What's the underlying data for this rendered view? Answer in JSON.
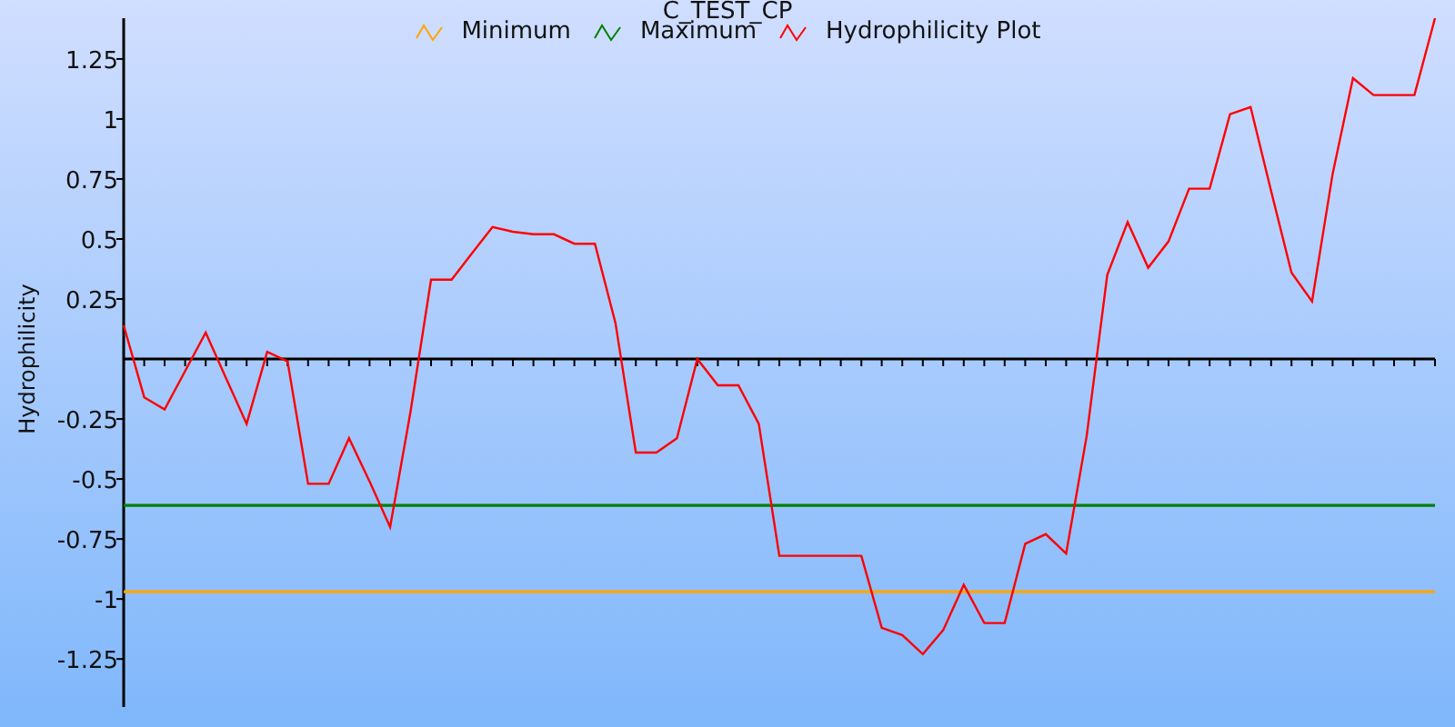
{
  "plot": {
    "chart_data": {
      "type": "line",
      "title": "C_TEST_CP",
      "legend": true,
      "ylabel": "Hydrophilicity",
      "ylim": [
        -1.45,
        1.42
      ],
      "yticks": [
        -1.25,
        -1,
        -0.75,
        -0.5,
        -0.25,
        0.25,
        0.5,
        0.75,
        1,
        1.25
      ],
      "series": [
        {
          "name": "Minimum",
          "color": "#ffa500",
          "values": [
            -0.97,
            -0.97,
            -0.97,
            -0.97,
            -0.97,
            -0.97,
            -0.97,
            -0.97,
            -0.97,
            -0.97,
            -0.97,
            -0.97,
            -0.97,
            -0.97,
            -0.97,
            -0.97,
            -0.97,
            -0.97,
            -0.97,
            -0.97,
            -0.97,
            -0.97,
            -0.97,
            -0.97,
            -0.97,
            -0.97,
            -0.97,
            -0.97,
            -0.97,
            -0.97,
            -0.97,
            -0.97,
            -0.97,
            -0.97,
            -0.97,
            -0.97,
            -0.97,
            -0.97,
            -0.97,
            -0.97,
            -0.97,
            -0.97,
            -0.97,
            -0.97,
            -0.97,
            -0.97,
            -0.97,
            -0.97,
            -0.97,
            -0.97,
            -0.97,
            -0.97,
            -0.97,
            -0.97,
            -0.97,
            -0.97,
            -0.97,
            -0.97,
            -0.97,
            -0.97,
            -0.97,
            -0.97,
            -0.97,
            -0.97,
            -0.97
          ]
        },
        {
          "name": "Maximum",
          "color": "#008000",
          "values": [
            -0.61,
            -0.61,
            -0.61,
            -0.61,
            -0.61,
            -0.61,
            -0.61,
            -0.61,
            -0.61,
            -0.61,
            -0.61,
            -0.61,
            -0.61,
            -0.61,
            -0.61,
            -0.61,
            -0.61,
            -0.61,
            -0.61,
            -0.61,
            -0.61,
            -0.61,
            -0.61,
            -0.61,
            -0.61,
            -0.61,
            -0.61,
            -0.61,
            -0.61,
            -0.61,
            -0.61,
            -0.61,
            -0.61,
            -0.61,
            -0.61,
            -0.61,
            -0.61,
            -0.61,
            -0.61,
            -0.61,
            -0.61,
            -0.61,
            -0.61,
            -0.61,
            -0.61,
            -0.61,
            -0.61,
            -0.61,
            -0.61,
            -0.61,
            -0.61,
            -0.61,
            -0.61,
            -0.61,
            -0.61,
            -0.61,
            -0.61,
            -0.61,
            -0.61,
            -0.61,
            -0.61,
            -0.61,
            -0.61,
            -0.61,
            -0.61
          ]
        },
        {
          "name": "Hydrophilicity Plot",
          "color": "#ff0000",
          "values": [
            0.14,
            -0.16,
            -0.21,
            -0.05,
            0.11,
            -0.08,
            -0.27,
            0.03,
            -0.01,
            -0.52,
            -0.52,
            -0.33,
            -0.51,
            -0.7,
            -0.22,
            0.33,
            0.33,
            0.44,
            0.55,
            0.53,
            0.52,
            0.52,
            0.48,
            0.48,
            0.15,
            -0.39,
            -0.39,
            -0.33,
            0,
            -0.11,
            -0.11,
            -0.27,
            -0.82,
            -0.82,
            -0.82,
            -0.82,
            -0.82,
            -1.12,
            -1.15,
            -1.23,
            -1.13,
            -0.94,
            -1.1,
            -1.1,
            -0.77,
            -0.73,
            -0.81,
            -0.32,
            0.35,
            0.57,
            0.38,
            0.49,
            0.71,
            0.71,
            1.02,
            1.05,
            0.7,
            0.36,
            0.24,
            0.77,
            1.17,
            1.1,
            1.1,
            1.1,
            1.42
          ]
        }
      ]
    }
  }
}
